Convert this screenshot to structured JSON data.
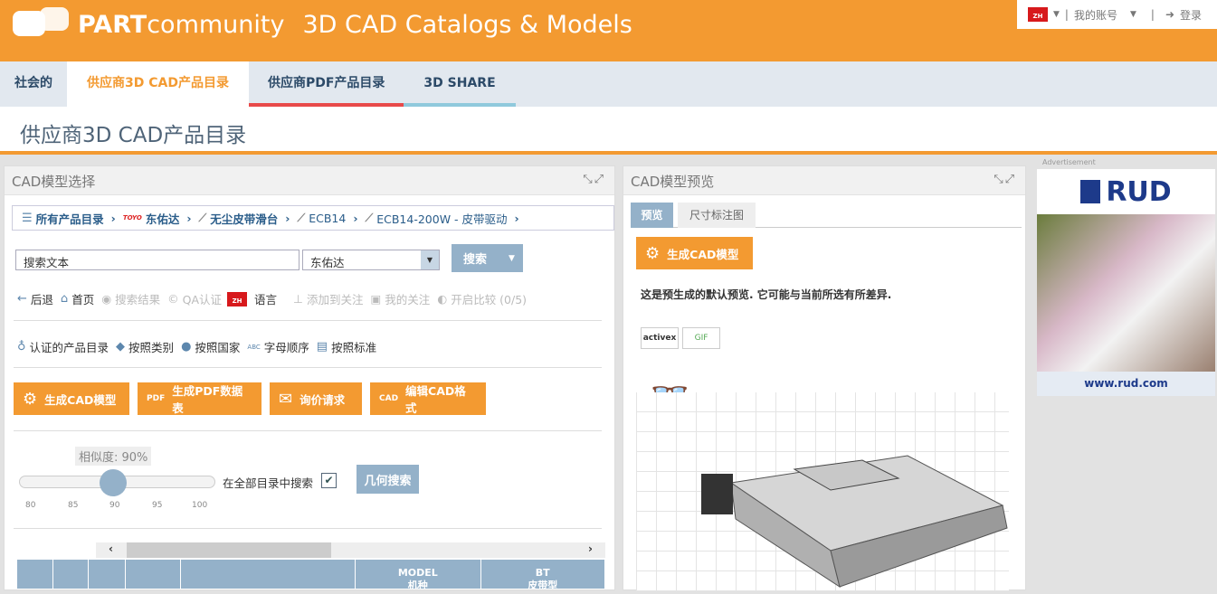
{
  "header": {
    "brand_bold": "PART",
    "brand_rest": "community",
    "tagline": "3D CAD Catalogs & Models",
    "lang_code": "ZH",
    "my_account": "我的账号",
    "login": "登录"
  },
  "tabs": [
    {
      "label": "社会的"
    },
    {
      "label": "供应商3D CAD产品目录"
    },
    {
      "label": "供应商PDF产品目录"
    },
    {
      "label": "3D SHARE"
    }
  ],
  "page_title": "供应商3D CAD产品目录",
  "left_panel": {
    "title": "CAD模型选择",
    "breadcrumb": [
      "所有产品目录",
      "东佑达",
      "无尘皮带滑台",
      "ECB14",
      "ECB14-200W - 皮带驱动"
    ],
    "brand_logo": "TOYO",
    "search_input": {
      "value": "搜索文本"
    },
    "catalog_select": {
      "value": "东佑达"
    },
    "search_button": "搜索",
    "nav": {
      "back": "后退",
      "home": "首页",
      "results": "搜索结果",
      "qa": "QA认证",
      "lang_flag": "ZH",
      "language": "语言",
      "add_watch": "添加到关注",
      "my_watch": "我的关注",
      "compare": "开启比较 (0/5)"
    },
    "filters": [
      "认证的产品目录",
      "按照类别",
      "按照国家",
      "字母顺序",
      "按照标准"
    ],
    "abc_label": "ABC",
    "actions": [
      "生成CAD模型",
      "生成PDF数据表",
      "询价请求",
      "编辑CAD格式"
    ],
    "action_icon_labels": {
      "pdf": "PDF",
      "cad": "CAD"
    },
    "similarity": {
      "label": "相似度: 90%",
      "value": 90,
      "min": 80,
      "max": 100,
      "ticks": [
        "80",
        "85",
        "90",
        "95",
        "100"
      ]
    },
    "search_all_label": "在全部目录中搜索",
    "search_all_checked": true,
    "geo_search": "几何搜索",
    "table_headers": [
      "",
      "",
      "",
      "",
      "",
      "MODEL\n机种",
      "BT\n皮带型"
    ]
  },
  "right_panel": {
    "title": "CAD模型预览",
    "tabs": [
      "预览",
      "尺寸标注图"
    ],
    "generate": "生成CAD模型",
    "notice": "这是预生成的默认预览. 它可能与当前所选有所差异.",
    "plugins": [
      "activex",
      "GIF"
    ]
  },
  "ad": {
    "label": "Advertisement",
    "brand": "RUD",
    "url": "www.rud.com"
  }
}
